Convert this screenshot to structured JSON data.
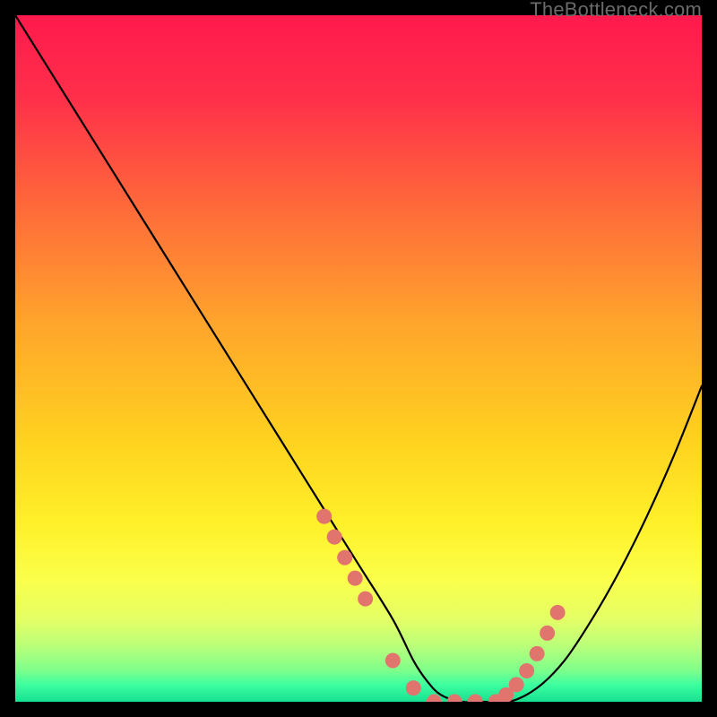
{
  "watermark": "TheBottleneck.com",
  "chart_data": {
    "type": "line",
    "title": "",
    "xlabel": "",
    "ylabel": "",
    "xlim": [
      0,
      100
    ],
    "ylim": [
      0,
      100
    ],
    "curve": {
      "name": "bottleneck-curve",
      "x": [
        0,
        5,
        10,
        15,
        20,
        25,
        30,
        35,
        40,
        45,
        50,
        55,
        58,
        60,
        62,
        65,
        68,
        72,
        76,
        80,
        84,
        88,
        92,
        96,
        100
      ],
      "y": [
        100,
        92,
        84,
        76,
        68,
        60,
        52,
        44,
        36,
        28,
        20,
        12,
        6,
        3,
        1,
        0,
        0,
        0,
        2,
        6,
        12,
        19,
        27,
        36,
        46
      ]
    },
    "marker_cluster": {
      "name": "highlight-dots",
      "color": "#e2746e",
      "x": [
        45,
        46.5,
        48,
        49.5,
        51,
        55,
        58,
        61,
        64,
        67,
        70,
        71.5,
        73,
        74.5,
        76,
        77.5,
        79
      ],
      "y": [
        27,
        24,
        21,
        18,
        15,
        6,
        2,
        0,
        0,
        0,
        0,
        1,
        2.5,
        4.5,
        7,
        10,
        13
      ]
    },
    "gradient_stops": [
      {
        "pos": 0.0,
        "color": "#ff1a4d"
      },
      {
        "pos": 0.12,
        "color": "#ff2f4a"
      },
      {
        "pos": 0.28,
        "color": "#ff6a3a"
      },
      {
        "pos": 0.45,
        "color": "#ffa52c"
      },
      {
        "pos": 0.62,
        "color": "#ffd21f"
      },
      {
        "pos": 0.74,
        "color": "#fff029"
      },
      {
        "pos": 0.82,
        "color": "#fbff4a"
      },
      {
        "pos": 0.88,
        "color": "#e4ff66"
      },
      {
        "pos": 0.92,
        "color": "#b8ff7a"
      },
      {
        "pos": 0.955,
        "color": "#7dff8c"
      },
      {
        "pos": 0.975,
        "color": "#3effa0"
      },
      {
        "pos": 1.0,
        "color": "#16e091"
      }
    ]
  }
}
